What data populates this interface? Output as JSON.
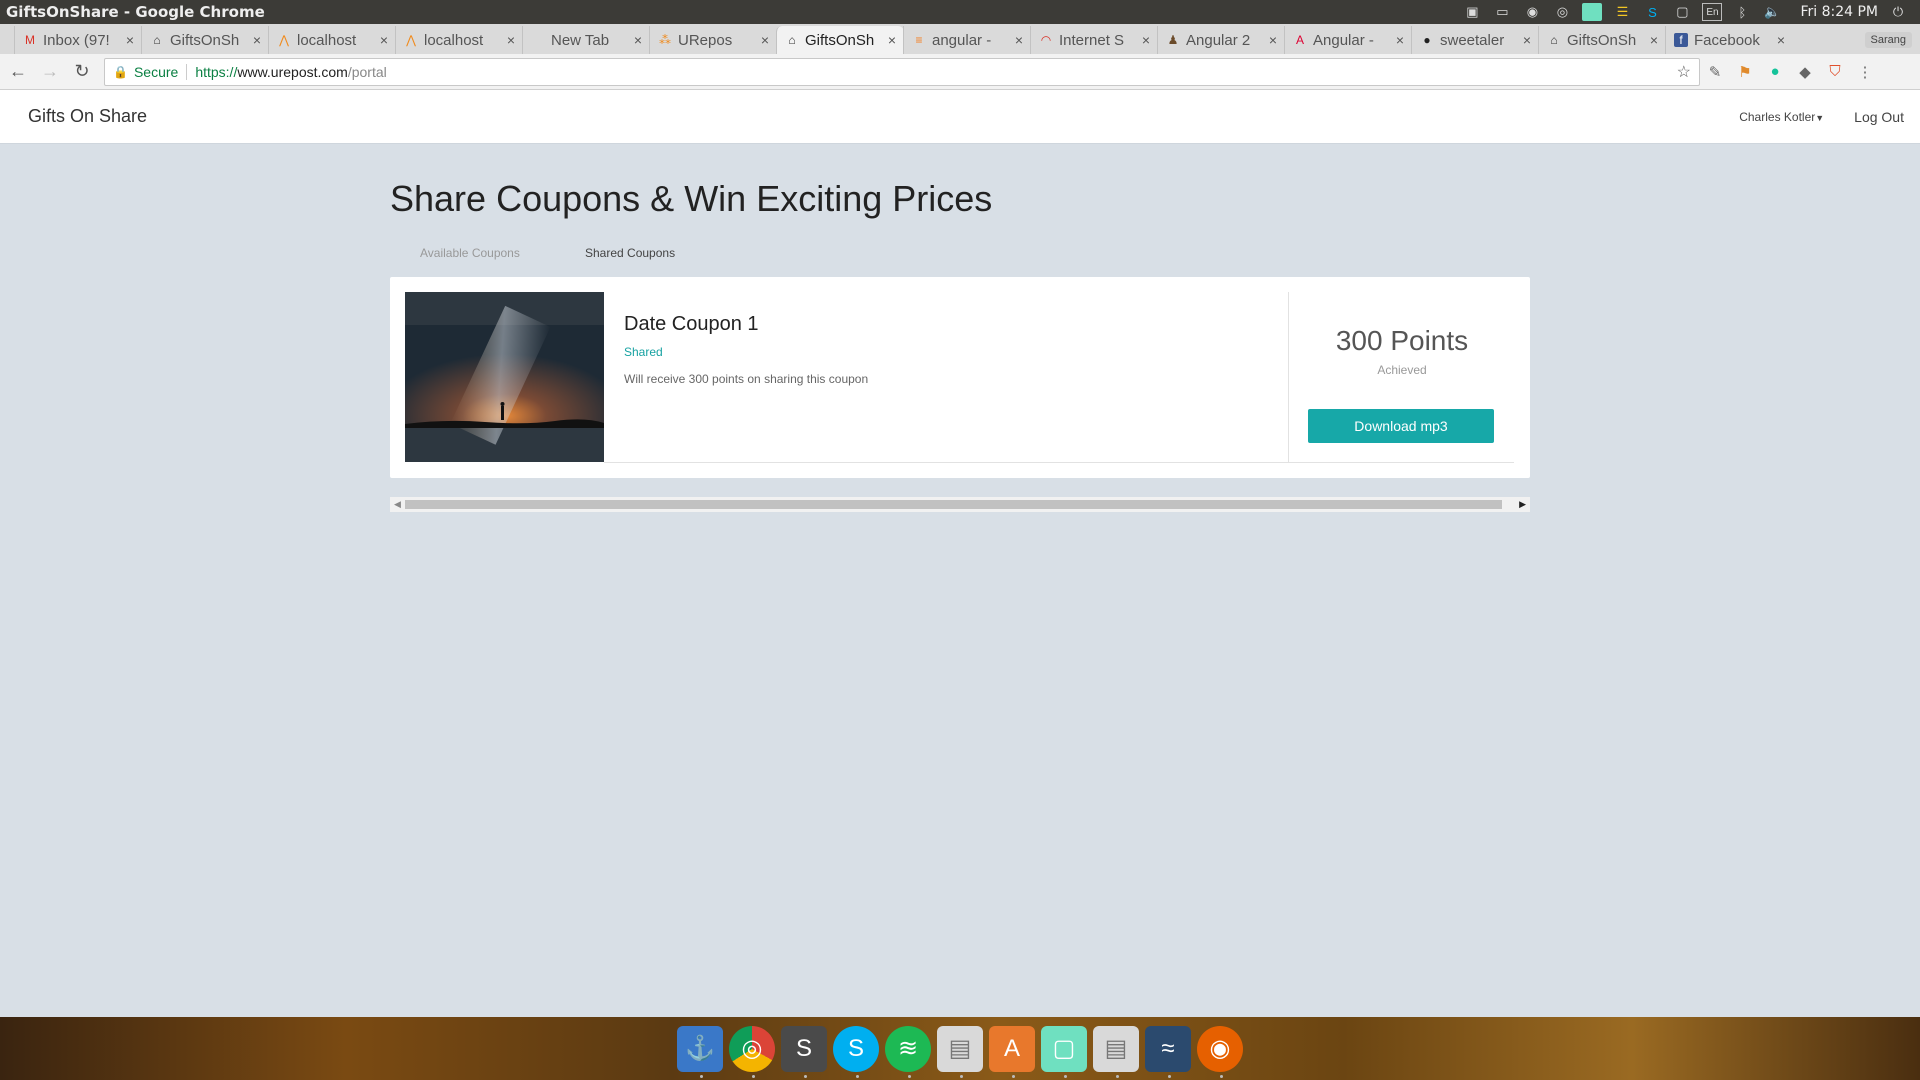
{
  "os": {
    "window_title": "GiftsOnShare - Google Chrome",
    "clock": "Fri 8:24 PM",
    "tray_icons": [
      "monitor-icon",
      "tray-window-icon",
      "nodejs-icon",
      "chrome-icon",
      "note-icon",
      "stickies-icon",
      "skype-icon",
      "square-icon",
      "keyboard-layout-icon",
      "bluetooth-icon",
      "volume-icon"
    ],
    "keyboard_layout": "En"
  },
  "browser": {
    "tabs": [
      {
        "label": "Inbox (97!",
        "icon": "gmail-icon",
        "color": "#d93025"
      },
      {
        "label": "GiftsOnSh",
        "icon": "gift-icon",
        "color": "#333"
      },
      {
        "label": "localhost",
        "icon": "xampp-icon",
        "color": "#f08a1c"
      },
      {
        "label": "localhost",
        "icon": "xampp-icon",
        "color": "#f08a1c"
      },
      {
        "label": "New Tab",
        "icon": "",
        "color": "#333"
      },
      {
        "label": "URepos",
        "icon": "urepost-icon",
        "color": "#f08a1c"
      },
      {
        "label": "GiftsOnSh",
        "icon": "gift-icon",
        "color": "#333"
      },
      {
        "label": "angular -",
        "icon": "stackoverflow-icon",
        "color": "#f48024"
      },
      {
        "label": "Internet S",
        "icon": "speedtest-icon",
        "color": "#d93025"
      },
      {
        "label": "Angular 2",
        "icon": "person-icon",
        "color": "#6b4b2a"
      },
      {
        "label": "Angular -",
        "icon": "angular-icon",
        "color": "#dd0031"
      },
      {
        "label": "sweetaler",
        "icon": "github-icon",
        "color": "#222"
      },
      {
        "label": "GiftsOnSh",
        "icon": "gift-icon",
        "color": "#333"
      },
      {
        "label": "Facebook",
        "icon": "facebook-icon",
        "color": "#3b5998"
      }
    ],
    "active_tab_index": 6,
    "profile_name": "Sarang",
    "address": {
      "secure_label": "Secure",
      "scheme": "https://",
      "host": "www.urepost.com",
      "path": "/portal"
    }
  },
  "app": {
    "brand": "Gifts On Share",
    "user_name": "Charles Kotler",
    "logout_label": "Log Out",
    "page_title": "Share Coupons & Win Exciting Prices",
    "tabs": [
      {
        "label": "Available Coupons",
        "active": false
      },
      {
        "label": "Shared Coupons",
        "active": true
      }
    ],
    "coupon": {
      "title": "Date Coupon 1",
      "status": "Shared",
      "description": "Will receive 300 points on sharing this coupon",
      "points": "300 Points",
      "points_caption": "Achieved",
      "button_label": "Download mp3"
    },
    "accent_color": "#17a8a8"
  },
  "dock": {
    "apps": [
      "anchor-icon",
      "chrome-icon",
      "sublime-text-icon",
      "skype-icon",
      "spotify-icon",
      "file-cabinet-icon",
      "software-center-icon",
      "note-app-icon",
      "file-cabinet-icon",
      "mysql-workbench-icon",
      "firefox-icon"
    ]
  }
}
